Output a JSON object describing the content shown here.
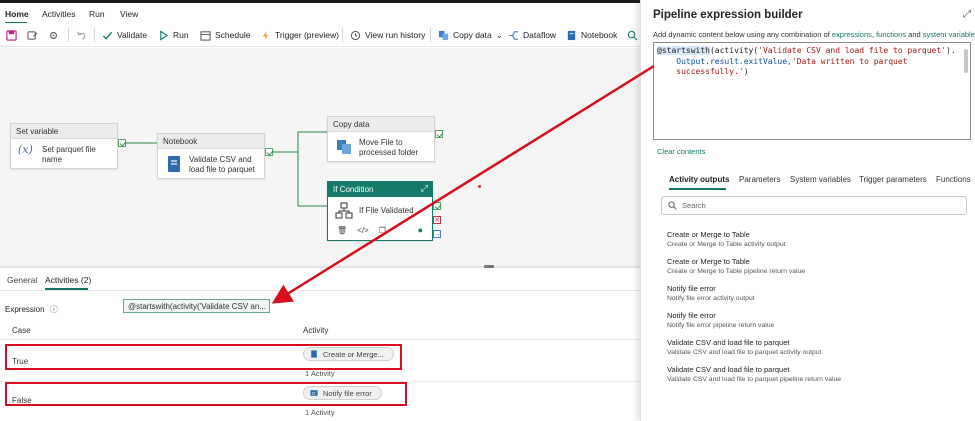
{
  "menu": {
    "items": [
      "Home",
      "Activities",
      "Run",
      "View"
    ]
  },
  "toolbar": {
    "validate": "Validate",
    "run": "Run",
    "schedule": "Schedule",
    "trigger": "Trigger (preview)",
    "history": "View run history",
    "copy_data": "Copy data",
    "dataflow": "Dataflow",
    "notebook": "Notebook"
  },
  "canvas": {
    "set_variable": {
      "header": "Set variable",
      "line1": "Set parquet file",
      "line2": "name"
    },
    "notebook": {
      "header": "Notebook",
      "line1": "Validate CSV and",
      "line2": "load file to parquet"
    },
    "copy_data": {
      "header": "Copy data",
      "line1": "Move File to",
      "line2": "processed folder"
    },
    "if_condition": {
      "header": "If Condition",
      "label": "If File Validated"
    }
  },
  "bottom": {
    "tabs": [
      "General",
      "Activities (2)"
    ],
    "expression_label": "Expression",
    "expression_value": "@startswith(activity('Validate CSV an...",
    "col_case": "Case",
    "col_activity": "Activity",
    "rows": [
      {
        "case": "True",
        "activity": "Create or Merge...",
        "count": "1 Activity"
      },
      {
        "case": "False",
        "activity": "Notify file error",
        "count": "1 Activity"
      }
    ]
  },
  "builder": {
    "title": "Pipeline expression builder",
    "subtitle_prefix": "Add dynamic content below using any combination of ",
    "sub_link1": "expressions",
    "sub_sep1": ", ",
    "sub_link2": "functions",
    "sub_sep2": " and ",
    "sub_link3": "system variables",
    "sub_end": ".",
    "code": {
      "fn": "@startswith",
      "open": "(activity(",
      "str1": "'Validate CSV and load file to parquet'",
      "close1": ").",
      "line2": "    Output.result.exitValue,",
      "str2a": "'Data written to parquet",
      "str2b": "    successfully.'",
      "close2": ")"
    },
    "clear": "Clear contents",
    "tabs": [
      "Activity outputs",
      "Parameters",
      "System variables",
      "Trigger parameters",
      "Functions"
    ],
    "search_placeholder": "Search",
    "outputs": [
      {
        "title": "Create or Merge to Table",
        "desc": "Create or Merge to Table activity output"
      },
      {
        "title": "Create or Merge to Table",
        "desc": "Create or Merge to Table pipeline return value"
      },
      {
        "title": "Notify file error",
        "desc": "Notify file error activity output"
      },
      {
        "title": "Notify file error",
        "desc": "Notify file error pipeline return value"
      },
      {
        "title": "Validate CSV and load file to parquet",
        "desc": "Validate CSV and load file to parquet activity output"
      },
      {
        "title": "Validate CSV and load file to parquet",
        "desc": "Validate CSV and load file to parquet pipeline return value"
      }
    ]
  },
  "colors": {
    "accent": "#117865",
    "annotation": "#d60f1c",
    "if_header": "#147a6a"
  }
}
